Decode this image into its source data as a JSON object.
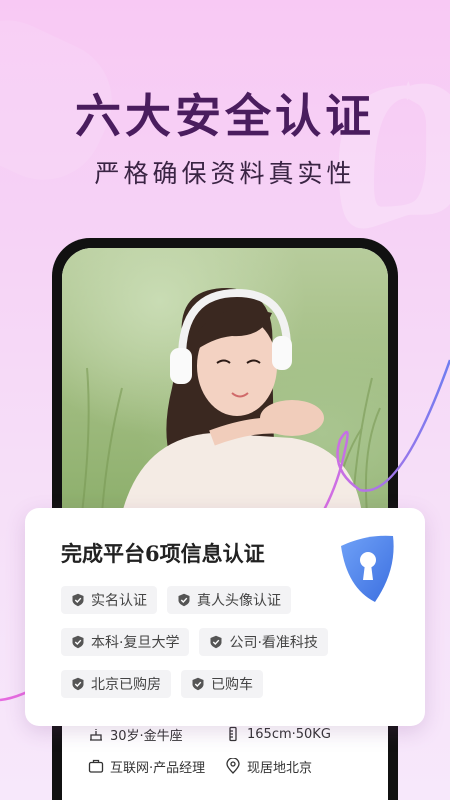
{
  "headline": "六大安全认证",
  "subline": "严格确保资料真实性",
  "card": {
    "title": "完成平台6项信息认证",
    "tags": [
      [
        "实名认证",
        "真人头像认证"
      ],
      [
        "本科·复旦大学",
        "公司·看准科技"
      ],
      [
        "北京已购房",
        "已购车"
      ]
    ]
  },
  "profile": {
    "age_sign": "30岁·金牛座",
    "height_weight": "165cm·50KG",
    "job": "互联网·产品经理",
    "location": "现居地北京"
  },
  "colors": {
    "headline": "#4a1d5e",
    "shield_blue": "#4e86f0",
    "accent_pink": "#e55fe0"
  }
}
